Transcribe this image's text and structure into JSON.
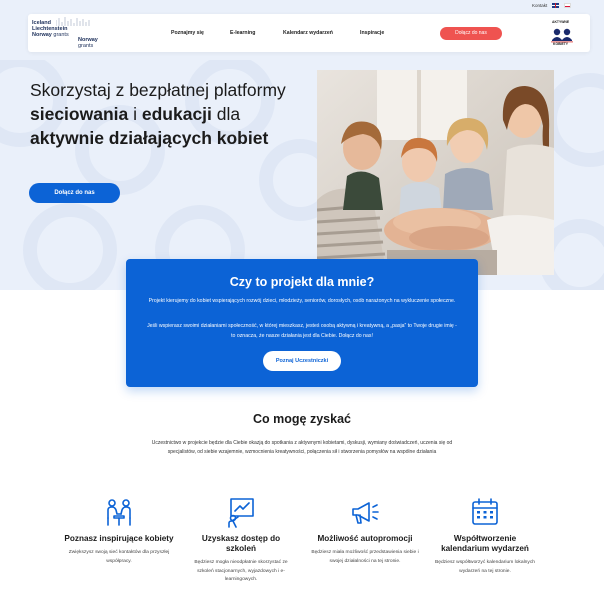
{
  "topbar": {
    "contact_label": "Kontakt"
  },
  "header": {
    "logo_line1": "Iceland",
    "logo_line2": "Liechtenstein",
    "logo_line3a": "Norway",
    "logo_line3b": "grants",
    "logo_norway1": "Norway",
    "logo_norway2": "grants",
    "nav": [
      "Poznajmy się",
      "E-learning",
      "Kalendarz wydarzeń",
      "Inspiracje"
    ],
    "join_button": "Dołącz do nas",
    "ak_logo_top": "AKTYWNE",
    "ak_logo_bottom": "KOBIETY"
  },
  "hero": {
    "title_a": "Skorzystaj z bezpłatnej platformy ",
    "title_b": "sieciowania",
    "title_c": " i ",
    "title_d": "edukacji",
    "title_e": " dla ",
    "title_f": "aktywnie działających kobiet",
    "join_button": "Dołącz do nas"
  },
  "card": {
    "title": "Czy to projekt dla mnie?",
    "paragraph1": "Projekt kierujemy do kobiet wspierających rozwój dzieci, młodzieży, seniorów, dorosłych, osób narażonych na wykluczenie społeczne.",
    "paragraph2": "Jeśli wspierasz swoimi działaniami społeczność, w której mieszkasz, jesteś osobą aktywną i kreatywną, a „pasja” to Twoje drugie imię - to oznacza, że nasze działania jest dla Ciebie. Dołącz do nas!",
    "button": "Poznaj Uczestniczki"
  },
  "gains": {
    "title": "Co mogę zyskać",
    "intro": "Uczestnictwo w projekcie będzie dla Ciebie okazją do spotkania z aktywnymi kobietami, dyskusji, wymiany doświadczeń, uczenia się od specjalistów, od siebie wzajemnie, wzmocnienia kreatywności, połączenia sił i stworzenia pomysłów na wspólne działania",
    "features": [
      {
        "icon": "meeting-people-icon",
        "title": "Poznasz inspirujące kobiety",
        "text": "Zwiększysz swoją sieć kontaktów dla przyszłej współpracy."
      },
      {
        "icon": "presentation-board-icon",
        "title": "Uzyskasz dostęp do szkoleń",
        "text": "Będziesz mogła nieodpłatnie skorzystać ze szkoleń stacjonarnych, wyjazdowych i e-learningowych."
      },
      {
        "icon": "megaphone-icon",
        "title": "Możliwość autopromocji",
        "text": "Będziesz miała możliwość przedstawienia siebie i swojej działalności na tej stronie."
      },
      {
        "icon": "calendar-icon",
        "title": "Współtworzenie kalendarium wydarzeń",
        "text": "Będziesz współtworzyć kalendarium lokalnych wydarzeń na tej stronie."
      }
    ]
  },
  "colors": {
    "primary_blue": "#0c63d6",
    "accent_red": "#ef5350",
    "hero_bg": "#eaf0fa"
  }
}
